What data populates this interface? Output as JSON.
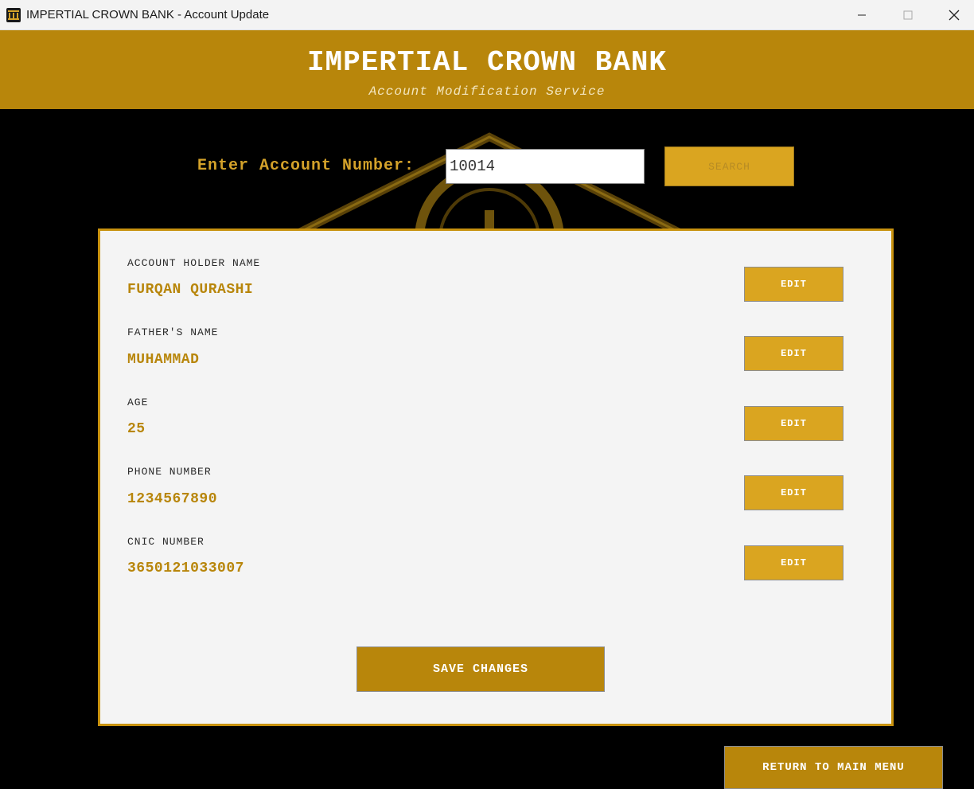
{
  "window": {
    "title": "IMPERTIAL CROWN BANK - Account Update"
  },
  "banner": {
    "title": "IMPERTIAL CROWN BANK",
    "subtitle": "Account Modification Service"
  },
  "search": {
    "label": "Enter Account Number:",
    "value": "10014",
    "button_label": "SEARCH"
  },
  "fields": [
    {
      "label": "ACCOUNT HOLDER NAME",
      "value": "FURQAN QURASHI",
      "edit_label": "EDIT"
    },
    {
      "label": "FATHER'S NAME",
      "value": "MUHAMMAD",
      "edit_label": "EDIT"
    },
    {
      "label": "AGE",
      "value": "25",
      "edit_label": "EDIT"
    },
    {
      "label": "PHONE NUMBER",
      "value": "1234567890",
      "edit_label": "EDIT"
    },
    {
      "label": "CNIC NUMBER",
      "value": "3650121033007",
      "edit_label": "EDIT"
    }
  ],
  "actions": {
    "save_label": "SAVE CHANGES",
    "return_label": "RETURN TO MAIN MENU"
  },
  "colors": {
    "brand_gold": "#b8860b",
    "button_gold": "#daa520",
    "background": "#000000",
    "panel": "#f4f4f4"
  }
}
